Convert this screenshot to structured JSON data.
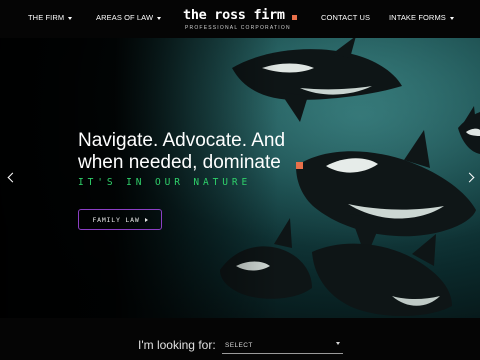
{
  "nav": {
    "items": [
      {
        "label": "THE FIRM",
        "dropdown": true
      },
      {
        "label": "AREAS OF LAW",
        "dropdown": true
      },
      {
        "label": "CONTACT US",
        "dropdown": false
      },
      {
        "label": "INTAKE FORMS",
        "dropdown": true
      }
    ]
  },
  "logo": {
    "name": "the ross firm",
    "subtitle": "PROFESSIONAL CORPORATION"
  },
  "hero": {
    "headline": "Navigate. Advocate. And when needed, dominate",
    "tagline": "IT'S IN OUR NATURE",
    "cta_label": "FAMILY LAW"
  },
  "finder": {
    "label": "I'm looking for:",
    "select_value": "SELECT"
  },
  "colors": {
    "accent_orange": "#e8704a",
    "tagline_green": "#2fd06a",
    "cta_border_purple": "#8b3fc4",
    "nav_background": "#050505"
  },
  "icons": [
    "chevron-left-icon",
    "chevron-right-icon",
    "caret-down-icon",
    "play-arrow-icon"
  ]
}
